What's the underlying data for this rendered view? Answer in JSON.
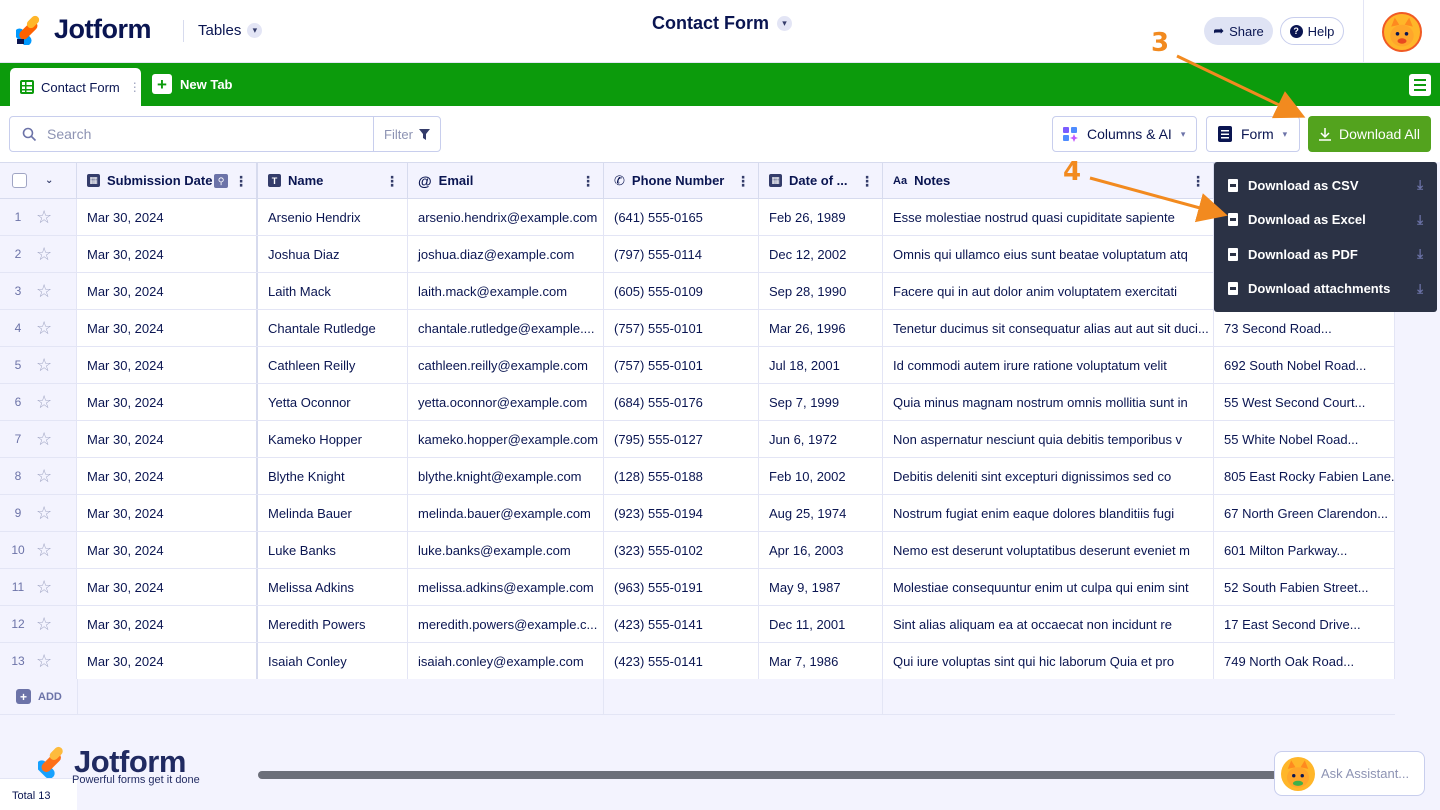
{
  "app": {
    "brand": "Jotform",
    "section": "Tables",
    "title": "Contact Form",
    "share": "Share",
    "help": "Help",
    "colors": {
      "green": "#0c9b0c",
      "download": "#53a31e",
      "navy": "#0a1551",
      "orange": "#f28a1f"
    }
  },
  "tabs": {
    "active": "Contact Form",
    "new": "New Tab"
  },
  "toolbar": {
    "search_placeholder": "Search",
    "filter": "Filter",
    "columns": "Columns & AI",
    "form": "Form",
    "download_all": "Download All"
  },
  "table": {
    "columns": [
      "Submission Date",
      "Name",
      "Email",
      "Phone Number",
      "Date of ...",
      "Notes"
    ],
    "rows": [
      {
        "n": "1",
        "date": "Mar 30, 2024",
        "name": "Arsenio Hendrix",
        "email": "arsenio.hendrix@example.com",
        "phone": "(641) 555-0165",
        "dob": "Feb 26, 1989",
        "notes": "Esse molestiae nostrud quasi cupiditate sapiente",
        "addr": ""
      },
      {
        "n": "2",
        "date": "Mar 30, 2024",
        "name": "Joshua Diaz",
        "email": "joshua.diaz@example.com",
        "phone": "(797) 555-0114",
        "dob": "Dec 12, 2002",
        "notes": "Omnis qui ullamco eius sunt beatae voluptatum atq",
        "addr": ""
      },
      {
        "n": "3",
        "date": "Mar 30, 2024",
        "name": "Laith Mack",
        "email": "laith.mack@example.com",
        "phone": "(605) 555-0109",
        "dob": "Sep 28, 1990",
        "notes": "Facere qui in aut dolor anim voluptatem exercitati",
        "addr": ""
      },
      {
        "n": "4",
        "date": "Mar 30, 2024",
        "name": "Chantale Rutledge",
        "email": "chantale.rutledge@example....",
        "phone": "(757) 555-0101",
        "dob": "Mar 26, 1996",
        "notes": "Tenetur ducimus sit consequatur alias aut aut sit duci...",
        "addr": "73 Second Road..."
      },
      {
        "n": "5",
        "date": "Mar 30, 2024",
        "name": "Cathleen Reilly",
        "email": "cathleen.reilly@example.com",
        "phone": "(757) 555-0101",
        "dob": "Jul 18, 2001",
        "notes": "Id commodi autem irure ratione voluptatum velit",
        "addr": "692 South Nobel Road..."
      },
      {
        "n": "6",
        "date": "Mar 30, 2024",
        "name": "Yetta Oconnor",
        "email": "yetta.oconnor@example.com",
        "phone": "(684) 555-0176",
        "dob": "Sep 7, 1999",
        "notes": "Quia minus magnam nostrum omnis mollitia sunt in",
        "addr": "55 West Second Court..."
      },
      {
        "n": "7",
        "date": "Mar 30, 2024",
        "name": "Kameko Hopper",
        "email": "kameko.hopper@example.com",
        "phone": "(795) 555-0127",
        "dob": "Jun 6, 1972",
        "notes": "Non aspernatur nesciunt quia debitis temporibus v",
        "addr": "55 White Nobel Road..."
      },
      {
        "n": "8",
        "date": "Mar 30, 2024",
        "name": "Blythe Knight",
        "email": "blythe.knight@example.com",
        "phone": "(128) 555-0188",
        "dob": "Feb 10, 2002",
        "notes": "Debitis deleniti sint excepturi dignissimos sed co",
        "addr": "805 East Rocky Fabien Lane..."
      },
      {
        "n": "9",
        "date": "Mar 30, 2024",
        "name": "Melinda Bauer",
        "email": "melinda.bauer@example.com",
        "phone": "(923) 555-0194",
        "dob": "Aug 25, 1974",
        "notes": "Nostrum fugiat enim eaque dolores blanditiis fugi",
        "addr": "67 North Green Clarendon..."
      },
      {
        "n": "10",
        "date": "Mar 30, 2024",
        "name": "Luke Banks",
        "email": "luke.banks@example.com",
        "phone": "(323) 555-0102",
        "dob": "Apr 16, 2003",
        "notes": "Nemo est deserunt voluptatibus deserunt eveniet m",
        "addr": "601 Milton Parkway..."
      },
      {
        "n": "11",
        "date": "Mar 30, 2024",
        "name": "Melissa Adkins",
        "email": "melissa.adkins@example.com",
        "phone": "(963) 555-0191",
        "dob": "May 9, 1987",
        "notes": "Molestiae consequuntur enim ut culpa qui enim sint",
        "addr": "52 South Fabien Street..."
      },
      {
        "n": "12",
        "date": "Mar 30, 2024",
        "name": "Meredith Powers",
        "email": "meredith.powers@example.c...",
        "phone": "(423) 555-0141",
        "dob": "Dec 11, 2001",
        "notes": "Sint alias aliquam ea at occaecat non incidunt re",
        "addr": "17 East Second Drive..."
      },
      {
        "n": "13",
        "date": "Mar 30, 2024",
        "name": "Isaiah Conley",
        "email": "isaiah.conley@example.com",
        "phone": "(423) 555-0141",
        "dob": "Mar 7, 1986",
        "notes": "Qui iure voluptas sint qui hic laborum Quia et pro",
        "addr": "749 North Oak Road..."
      }
    ],
    "add": "ADD",
    "total": "Total 13"
  },
  "download_menu": [
    {
      "label": "Download as CSV",
      "ext": "CSV"
    },
    {
      "label": "Download as Excel",
      "ext": "XLS"
    },
    {
      "label": "Download as PDF",
      "ext": "PDF"
    },
    {
      "label": "Download attachments",
      "ext": "ATT"
    }
  ],
  "annotations": {
    "step3": "3",
    "step4": "4"
  },
  "watermark": {
    "brand": "Jotform",
    "tagline": "Powerful forms get it done"
  },
  "assistant": "Ask Assistant..."
}
